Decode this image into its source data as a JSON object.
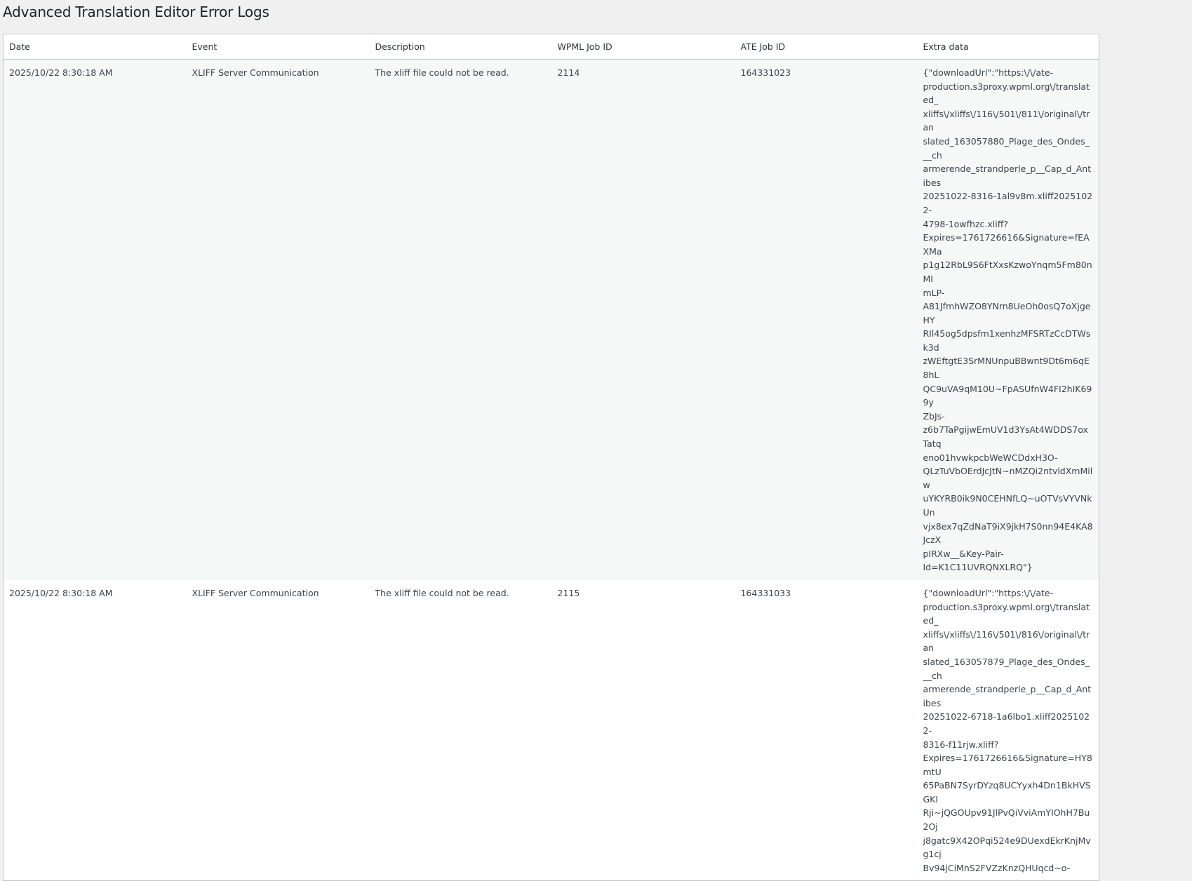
{
  "page": {
    "title": "Advanced Translation Editor Error Logs"
  },
  "table": {
    "headers": [
      "Date",
      "Event",
      "Description",
      "WPML Job ID",
      "ATE Job ID",
      "Extra data"
    ],
    "rows": [
      {
        "date": "2025/10/22 8:30:18 AM",
        "event": "XLIFF Server Communication",
        "description": "The xliff file could not be read.",
        "wpml_job_id": "2114",
        "ate_job_id": "164331023",
        "extra": "{\"downloadUrl\":\"https:\\/\\/ate-\nproduction.s3proxy.wpml.org\\/translated_\nxliffs\\/xliffs\\/116\\/501\\/811\\/original\\/tran\nslated_163057880_Plage_des_Ondes___ch\narmerende_strandperle_p__Cap_d_Antibes\n20251022-8316-1al9v8m.xliff20251022-\n4798-1owfhzc.xliff?\nExpires=1761726616&Signature=fEAXMa\np1g12RbL9S6FtXxsKzwoYnqm5Fm80nMI\nmLP-\nA81JfmhWZO8YNrn8UeOh0osQ7oXjgeHY\nRIl45og5dpsfm1xenhzMFSRTzCcDTWsk3d\nzWEftgtE3SrMNUnpuBBwnt9Dt6m6qE8hL\nQC9uVA9qM10U~FpASUfnW4FI2hIK699y\nZbJs-\nz6b7TaPgijwEmUV1d3YsAt4WDDS7oxTatq\neno01hvwkpcbWeWCDdxH3O-\nQLzTuVbOErdJcJtN~nMZQi2ntvldXmMilw\nuYKYRB0ik9N0CEHNfLQ~uOTVsVYVNkUn\nvjx8ex7qZdNaT9iX9jkH7S0nn94E4KA8JczX\npIRXw__&Key-Pair-\nId=K1C11UVRQNXLRQ\"}"
      },
      {
        "date": "2025/10/22 8:30:18 AM",
        "event": "XLIFF Server Communication",
        "description": "The xliff file could not be read.",
        "wpml_job_id": "2115",
        "ate_job_id": "164331033",
        "extra": "{\"downloadUrl\":\"https:\\/\\/ate-\nproduction.s3proxy.wpml.org\\/translated_\nxliffs\\/xliffs\\/116\\/501\\/816\\/original\\/tran\nslated_163057879_Plage_des_Ondes___ch\narmerende_strandperle_p__Cap_d_Antibes\n20251022-6718-1a6lbo1.xliff20251022-\n8316-f11rjw.xliff?\nExpires=1761726616&Signature=HY8mtU\n65PaBN7SyrDYzq8UCYyxh4Dn1BkHVSGKI\nRji~jQGOUpv91JlPvQiVviAmYIOhH7Bu2Oj\nj8gatc9X42OPqi524e9DUexdEkrKnjMvg1cj\nBv94jCiMnS2FVZzKnzQHUqcd~o-"
      }
    ]
  }
}
